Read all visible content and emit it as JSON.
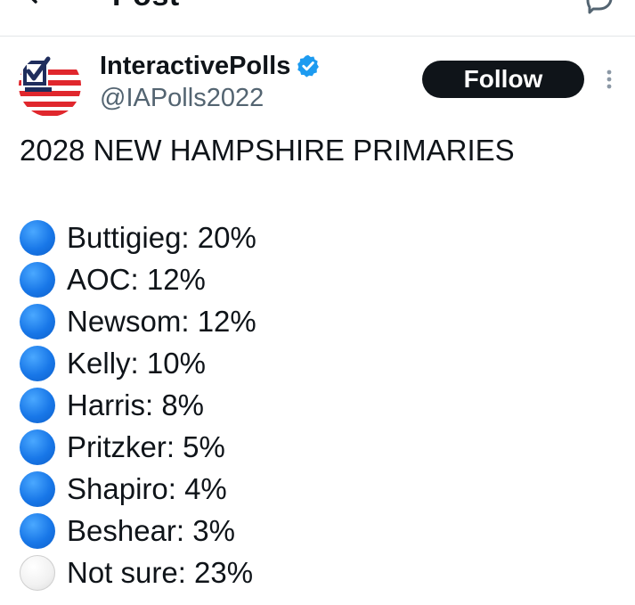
{
  "header": {
    "title": "Post"
  },
  "post": {
    "author": {
      "display_name": "InteractivePolls",
      "handle": "@IAPolls2022",
      "verified": true
    },
    "follow_label": "Follow",
    "headline": "2028 NEW HAMPSHIRE PRIMARIES",
    "poll_items": [
      {
        "label": "Buttigieg: 20%",
        "dot": "blue"
      },
      {
        "label": "AOC: 12%",
        "dot": "blue"
      },
      {
        "label": "Newsom: 12%",
        "dot": "blue"
      },
      {
        "label": "Kelly: 10%",
        "dot": "blue"
      },
      {
        "label": "Harris: 8%",
        "dot": "blue"
      },
      {
        "label": "Pritzker: 5%",
        "dot": "blue"
      },
      {
        "label": "Shapiro: 4%",
        "dot": "blue"
      },
      {
        "label": "Beshear: 3%",
        "dot": "blue"
      },
      {
        "label": "Not sure: 23%",
        "dot": "white"
      }
    ]
  },
  "icons": {
    "back": "arrow-left-icon",
    "reply": "reply-icon",
    "verified": "verified-badge-icon",
    "more": "more-vertical-icon",
    "blue_dot": "blue-circle-emoji",
    "white_dot": "white-circle-emoji"
  },
  "colors": {
    "text_primary": "#0f1419",
    "text_secondary": "#536471",
    "verified_blue": "#1d9bf0",
    "follow_bg": "#0f1419",
    "follow_text": "#ffffff",
    "divider": "#e3e6e8"
  }
}
